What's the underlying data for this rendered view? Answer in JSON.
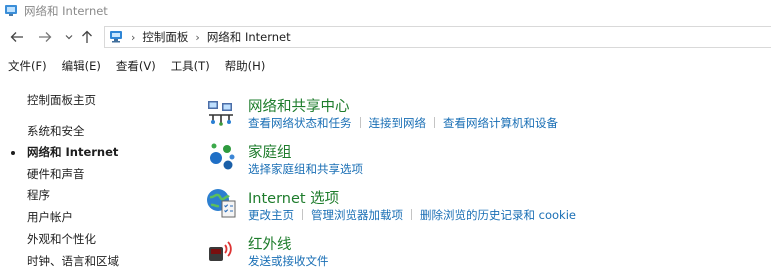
{
  "window": {
    "title": "网络和 Internet"
  },
  "breadcrumb": [
    "控制面板",
    "网络和 Internet"
  ],
  "menu": [
    "文件(F)",
    "编辑(E)",
    "查看(V)",
    "工具(T)",
    "帮助(H)"
  ],
  "sidebar": {
    "items": [
      {
        "label": "控制面板主页",
        "active": false
      },
      {
        "label": "系统和安全",
        "active": false
      },
      {
        "label": "网络和 Internet",
        "active": true
      },
      {
        "label": "硬件和声音",
        "active": false
      },
      {
        "label": "程序",
        "active": false
      },
      {
        "label": "用户帐户",
        "active": false
      },
      {
        "label": "外观和个性化",
        "active": false
      },
      {
        "label": "时钟、语言和区域",
        "active": false
      }
    ]
  },
  "sections": [
    {
      "title": "网络和共享中心",
      "icon": "network-sharing-center-icon",
      "links": [
        "查看网络状态和任务",
        "连接到网络",
        "查看网络计算机和设备"
      ]
    },
    {
      "title": "家庭组",
      "icon": "homegroup-icon",
      "links": [
        "选择家庭组和共享选项"
      ]
    },
    {
      "title": "Internet 选项",
      "icon": "internet-options-icon",
      "links": [
        "更改主页",
        "管理浏览器加载项",
        "删除浏览的历史记录和 cookie"
      ]
    },
    {
      "title": "红外线",
      "icon": "infrared-icon",
      "links": [
        "发送或接收文件"
      ]
    }
  ],
  "colors": {
    "section_title": "#1e7c2c",
    "link": "#1a6fb5"
  }
}
